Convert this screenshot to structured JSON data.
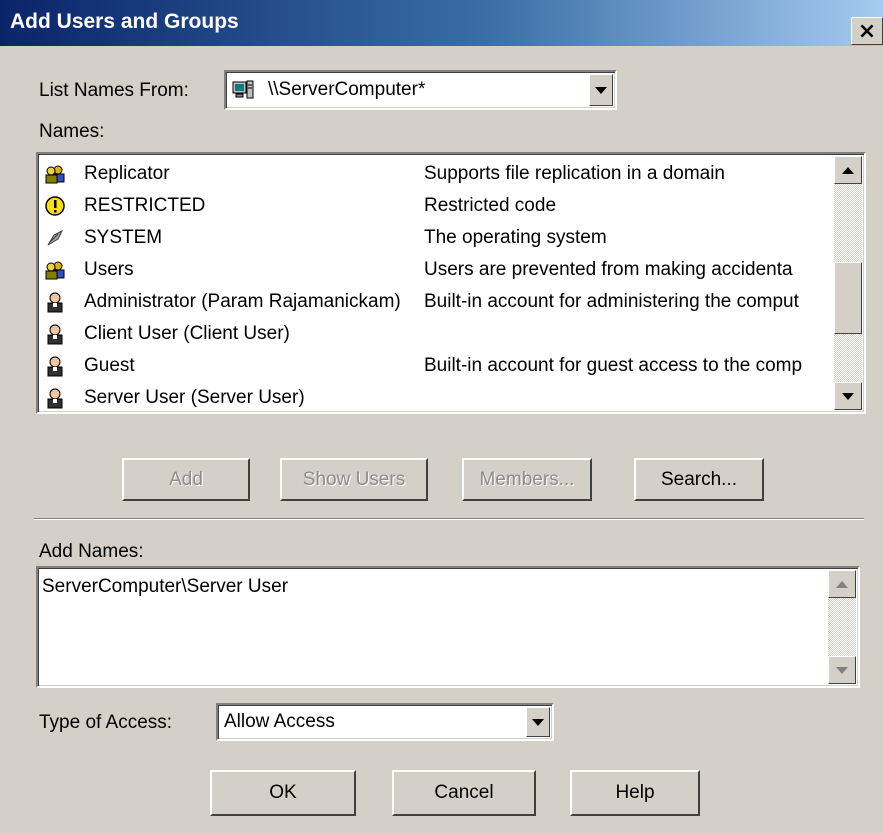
{
  "window": {
    "title": "Add Users and Groups",
    "close_label": "×"
  },
  "list_names_from": {
    "label": "List Names From:",
    "value": "\\\\ServerComputer*",
    "icon": "server-computer-icon"
  },
  "names": {
    "label": "Names:",
    "rows": [
      {
        "name": "Replicator",
        "description": "Supports file replication in a domain",
        "icon": "group-icon"
      },
      {
        "name": "RESTRICTED",
        "description": "Restricted code",
        "icon": "warning-icon"
      },
      {
        "name": "SYSTEM",
        "description": "The operating system",
        "icon": "system-icon"
      },
      {
        "name": "Users",
        "description": "Users are prevented from making accidenta",
        "icon": "group-icon"
      },
      {
        "name": "Administrator (Param Rajamanickam)",
        "description": "Built-in account for administering the comput",
        "icon": "user-icon"
      },
      {
        "name": "Client User (Client User)",
        "description": "",
        "icon": "user-icon"
      },
      {
        "name": "Guest",
        "description": "Built-in account for guest access to the comp",
        "icon": "user-icon"
      },
      {
        "name": "Server User (Server User)",
        "description": "",
        "icon": "user-icon"
      }
    ]
  },
  "buttons": {
    "add": "Add",
    "show_users": "Show Users",
    "members": "Members...",
    "search": "Search..."
  },
  "add_names": {
    "label": "Add Names:",
    "value": "ServerComputer\\Server User"
  },
  "type_of_access": {
    "label": "Type of Access:",
    "value": "Allow Access"
  },
  "footer": {
    "ok": "OK",
    "cancel": "Cancel",
    "help": "Help"
  },
  "colors": {
    "titlebar_start": "#0a246a",
    "titlebar_end": "#a6caf0",
    "face": "#d4d0c8"
  }
}
